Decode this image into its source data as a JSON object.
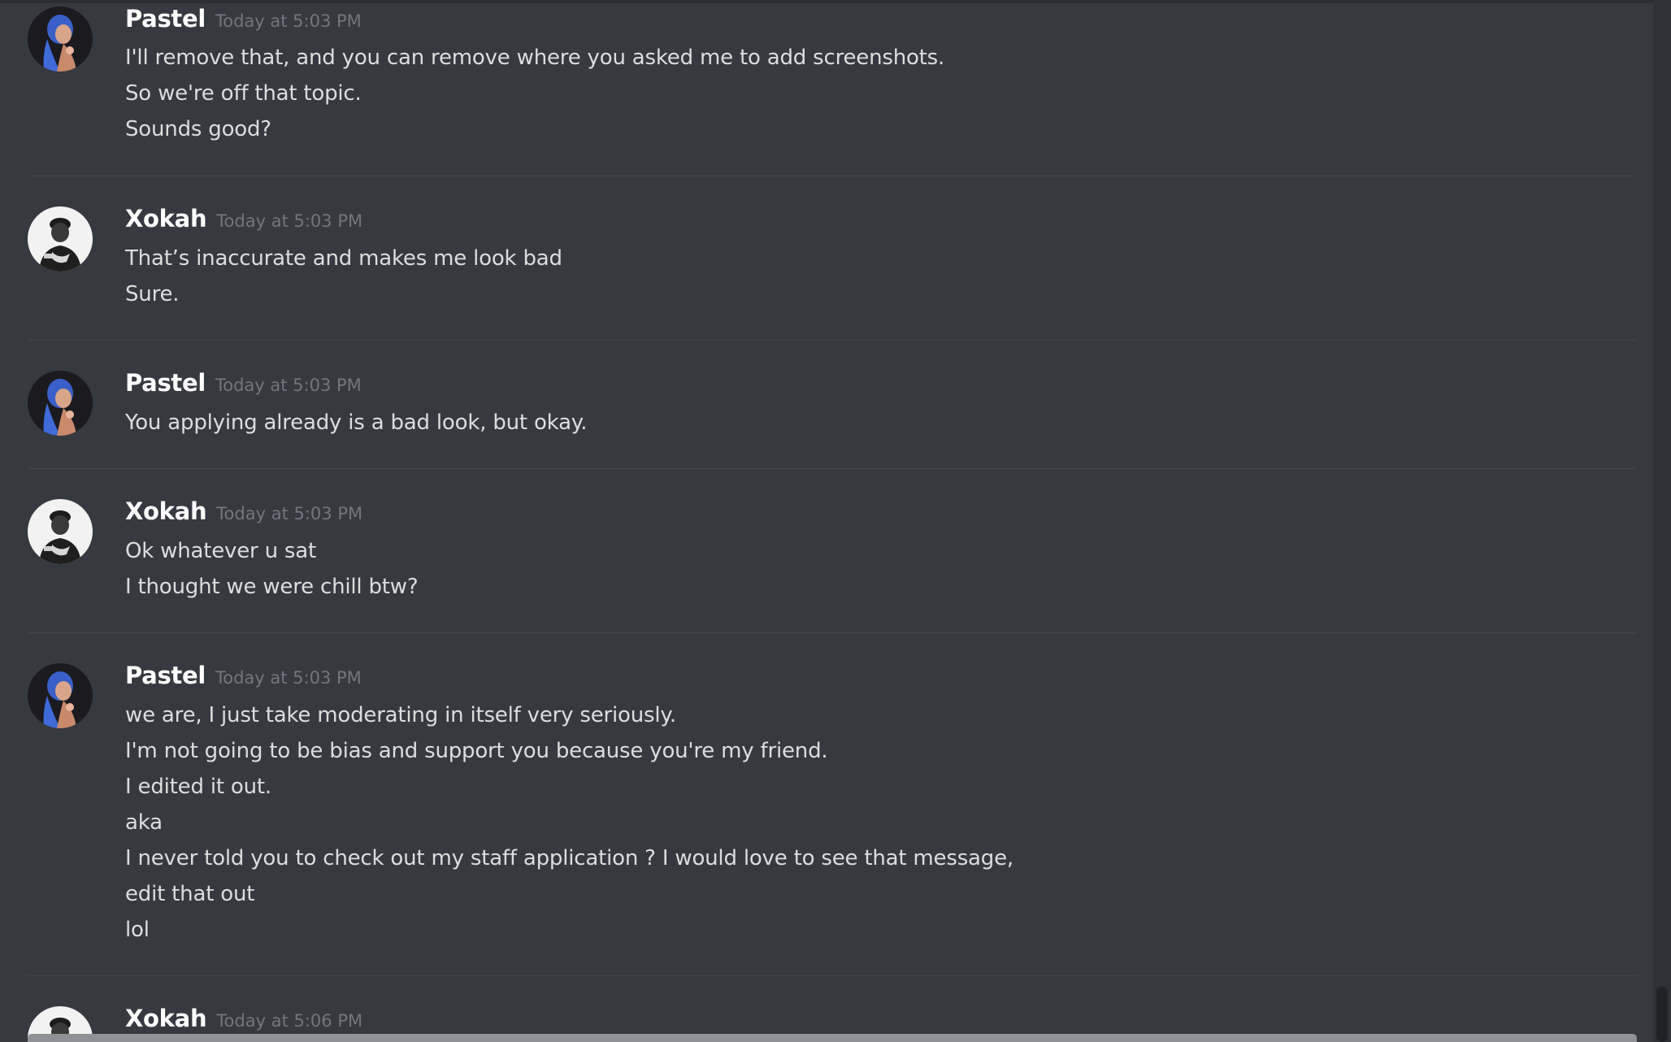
{
  "messages": [
    {
      "author": "Pastel",
      "timestamp": "Today at 5:03 PM",
      "avatar": "pastel-avatar",
      "lines": [
        "I'll remove that, and you can remove where you asked me to add screenshots.",
        "So we're off that topic.",
        "Sounds good?"
      ]
    },
    {
      "author": "Xokah",
      "timestamp": "Today at 5:03 PM",
      "avatar": "xokah-avatar",
      "lines": [
        "That’s inaccurate and makes me look bad",
        "Sure."
      ]
    },
    {
      "author": "Pastel",
      "timestamp": "Today at 5:03 PM",
      "avatar": "pastel-avatar",
      "lines": [
        "You applying already is a bad look, but okay."
      ]
    },
    {
      "author": "Xokah",
      "timestamp": "Today at 5:03 PM",
      "avatar": "xokah-avatar",
      "lines": [
        "Ok whatever u sat",
        "I thought we were chill btw?"
      ]
    },
    {
      "author": "Pastel",
      "timestamp": "Today at 5:03 PM",
      "avatar": "pastel-avatar",
      "lines": [
        "we are, I just take moderating in itself very seriously.",
        "I'm not going to be bias and support you because you're my friend.",
        "I edited it out.",
        "aka",
        "I never told you to check out my staff application ? I would love to see that message,",
        "edit that out",
        "lol"
      ]
    },
    {
      "author": "Xokah",
      "timestamp": "Today at 5:06 PM",
      "avatar": "xokah-avatar",
      "lines": []
    }
  ],
  "colors": {
    "background": "#36393f",
    "username": "#ffffff",
    "timestamp": "#72767d",
    "text": "#dcddde",
    "divider": "#42454b"
  }
}
